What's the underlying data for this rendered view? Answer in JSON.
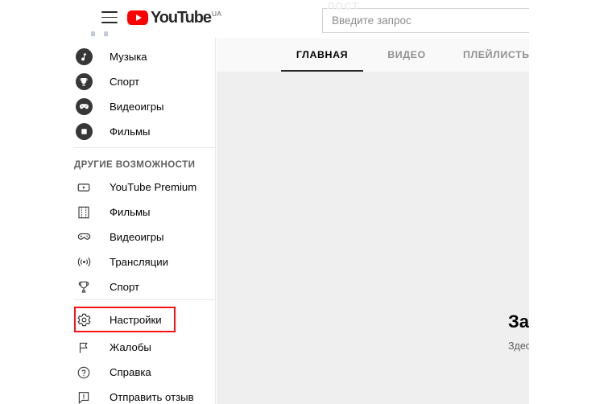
{
  "masthead": {
    "menu_icon": "hamburger-menu-icon",
    "logo_text": "YouTube",
    "logo_country": "UA",
    "ghost_text": "ЛОСТ",
    "search": {
      "value": "",
      "placeholder": "Введите запрос"
    }
  },
  "sidebar": {
    "top_items": [
      {
        "label": "Музыка",
        "icon": "music-note-icon"
      },
      {
        "label": "Спорт",
        "icon": "trophy-icon"
      },
      {
        "label": "Видеоигры",
        "icon": "gamepad-icon"
      },
      {
        "label": "Фильмы",
        "icon": "film-icon"
      }
    ],
    "section_title": "ДРУГИЕ ВОЗМОЖНОСТИ",
    "more_items": [
      {
        "label": "YouTube Premium",
        "icon": "youtube-premium-icon"
      },
      {
        "label": "Фильмы",
        "icon": "film-strip-icon"
      },
      {
        "label": "Видеоигры",
        "icon": "gamepad-outline-icon"
      },
      {
        "label": "Трансляции",
        "icon": "broadcast-icon"
      },
      {
        "label": "Спорт",
        "icon": "trophy-outline-icon"
      }
    ],
    "footer_items": [
      {
        "label": "Настройки",
        "icon": "gear-icon"
      },
      {
        "label": "Жалобы",
        "icon": "flag-icon"
      },
      {
        "label": "Справка",
        "icon": "help-circle-icon"
      },
      {
        "label": "Отправить отзыв",
        "icon": "feedback-icon"
      }
    ],
    "highlight_color": "#ff1111",
    "highlighted_item": "Настройки"
  },
  "content": {
    "tabs": [
      {
        "label": "ГЛАВНАЯ",
        "active": true
      },
      {
        "label": "ВИДЕО",
        "active": false
      },
      {
        "label": "ПЛЕЙЛИСТЫ",
        "active": false
      }
    ],
    "empty_state": {
      "heading": "За",
      "subtext": "Здес"
    }
  },
  "colors": {
    "brand_red": "#ff0000",
    "content_bg": "#efefef",
    "tabbar_bg": "#f9f9f9",
    "text_primary": "#030303",
    "text_secondary": "#606060"
  }
}
